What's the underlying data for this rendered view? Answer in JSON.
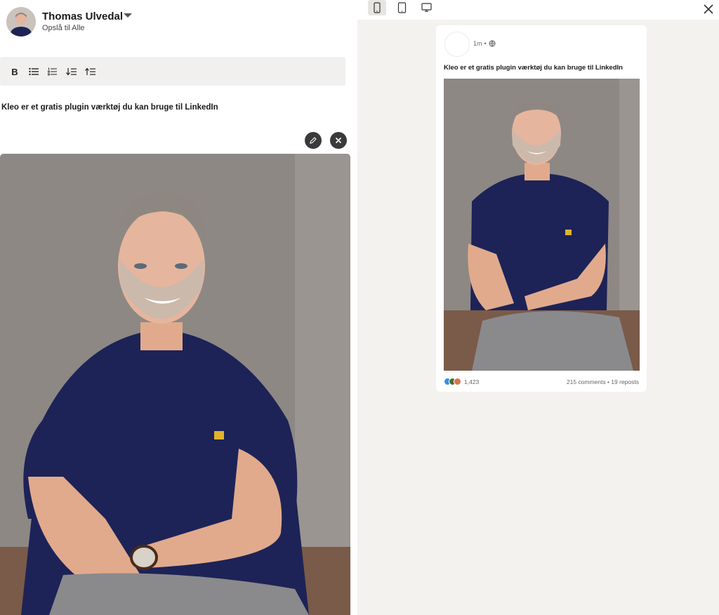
{
  "composer": {
    "author_name": "Thomas Ulvedal",
    "visibility": "Opslå til Alle",
    "toolbar": [
      {
        "icon": "bold-icon",
        "label": "B"
      },
      {
        "icon": "bullet-list-icon"
      },
      {
        "icon": "numbered-list-icon"
      },
      {
        "icon": "sort-descending-icon"
      },
      {
        "icon": "sort-ascending-icon"
      }
    ],
    "post_text": "Kleo er et gratis plugin værktøj du kan bruge til LinkedIn",
    "image_actions": [
      {
        "icon": "pencil-icon"
      },
      {
        "icon": "close-icon"
      }
    ]
  },
  "preview": {
    "view_modes": [
      {
        "icon": "mobile-icon",
        "active": true
      },
      {
        "icon": "tablet-icon",
        "active": false
      },
      {
        "icon": "desktop-icon",
        "active": false
      }
    ],
    "timestamp": "1m",
    "separator": "•",
    "post_text": "Kleo er et gratis plugin værktøj du kan bruge til LinkedIn",
    "reaction_count": "1,423",
    "stats": "215 comments • 19 reposts"
  },
  "colors": {
    "preview_background": "#f3f2ef",
    "toolbar_background": "#f1f0ee",
    "shirt": "#1d2357",
    "wall": "#8c8783",
    "trousers": "#8a8a8c"
  }
}
